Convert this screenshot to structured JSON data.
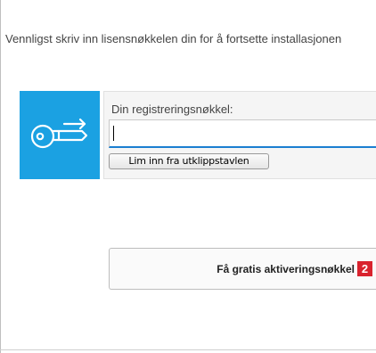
{
  "instruction_text": "Vennligst skriv inn lisensnøkkelen din for å fortsette installasjonen",
  "registration": {
    "label": "Din registreringsnøkkel:",
    "key_value": "",
    "paste_button_label": "Lim inn fra utklippstavlen"
  },
  "activation": {
    "button_label": "Få gratis aktiveringsnøkkel",
    "badge": "2"
  },
  "colors": {
    "key_tile": "#1ba1e2",
    "input_focus": "#1b7fd1",
    "badge": "#d9232e"
  },
  "icons": {
    "key_tile_icon": "key-icon"
  }
}
